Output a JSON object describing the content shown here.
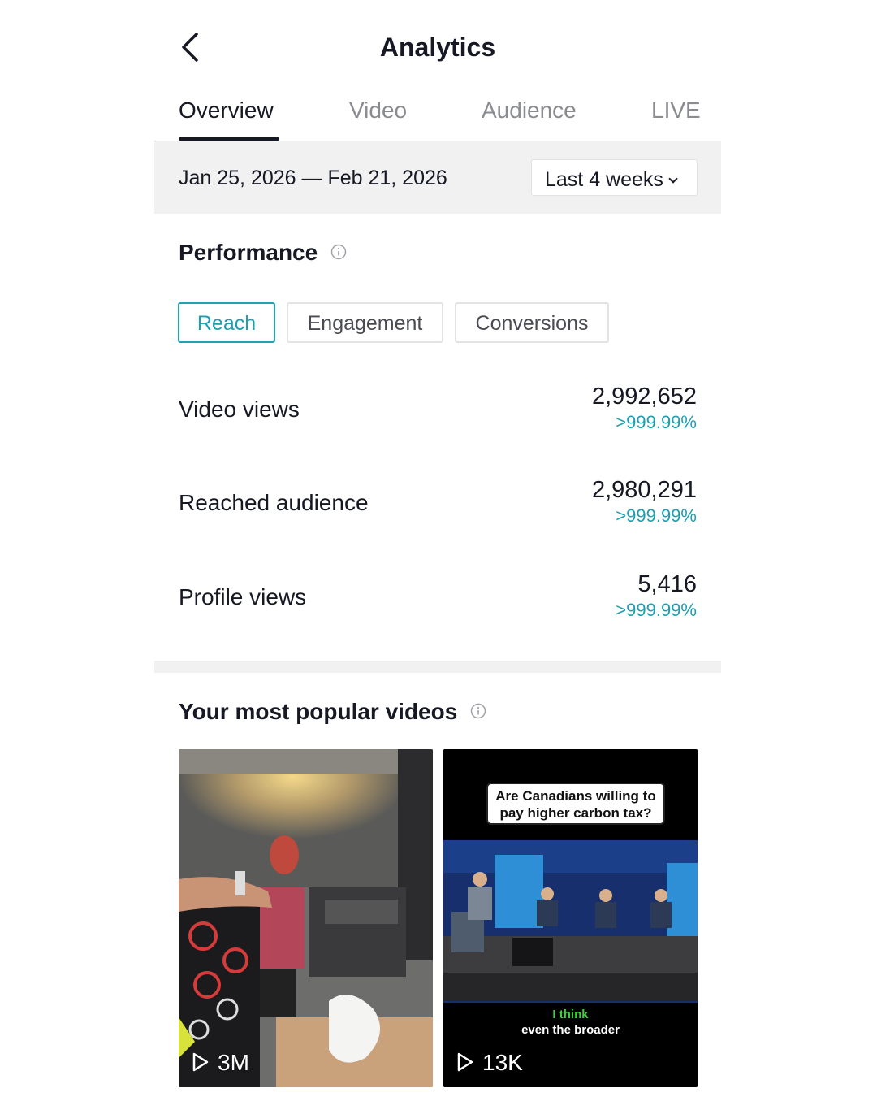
{
  "header": {
    "title": "Analytics"
  },
  "tabs": [
    {
      "label": "Overview",
      "active": true
    },
    {
      "label": "Video",
      "active": false
    },
    {
      "label": "Audience",
      "active": false
    },
    {
      "label": "LIVE",
      "active": false
    }
  ],
  "date_bar": {
    "range": "Jan 25, 2026 — Feb 21, 2026",
    "period": "Last 4 weeks"
  },
  "performance": {
    "title": "Performance",
    "chips": [
      {
        "label": "Reach",
        "active": true
      },
      {
        "label": "Engagement",
        "active": false
      },
      {
        "label": "Conversions",
        "active": false
      }
    ],
    "metrics": [
      {
        "label": "Video views",
        "value": "2,992,652",
        "change": ">999.99%"
      },
      {
        "label": "Reached audience",
        "value": "2,980,291",
        "change": ">999.99%"
      },
      {
        "label": "Profile views",
        "value": "5,416",
        "change": ">999.99%"
      }
    ]
  },
  "popular": {
    "title": "Your most popular videos",
    "videos": [
      {
        "views": "3M"
      },
      {
        "views": "13K",
        "caption": "Are Canadians willing to pay higher carbon tax?",
        "subtitle_line1": "I think",
        "subtitle_line2": "even the broader"
      }
    ]
  },
  "colors": {
    "accent": "#1d9fb0",
    "text": "#161823",
    "muted": "#8a8b91",
    "band": "#f1f1f2"
  }
}
